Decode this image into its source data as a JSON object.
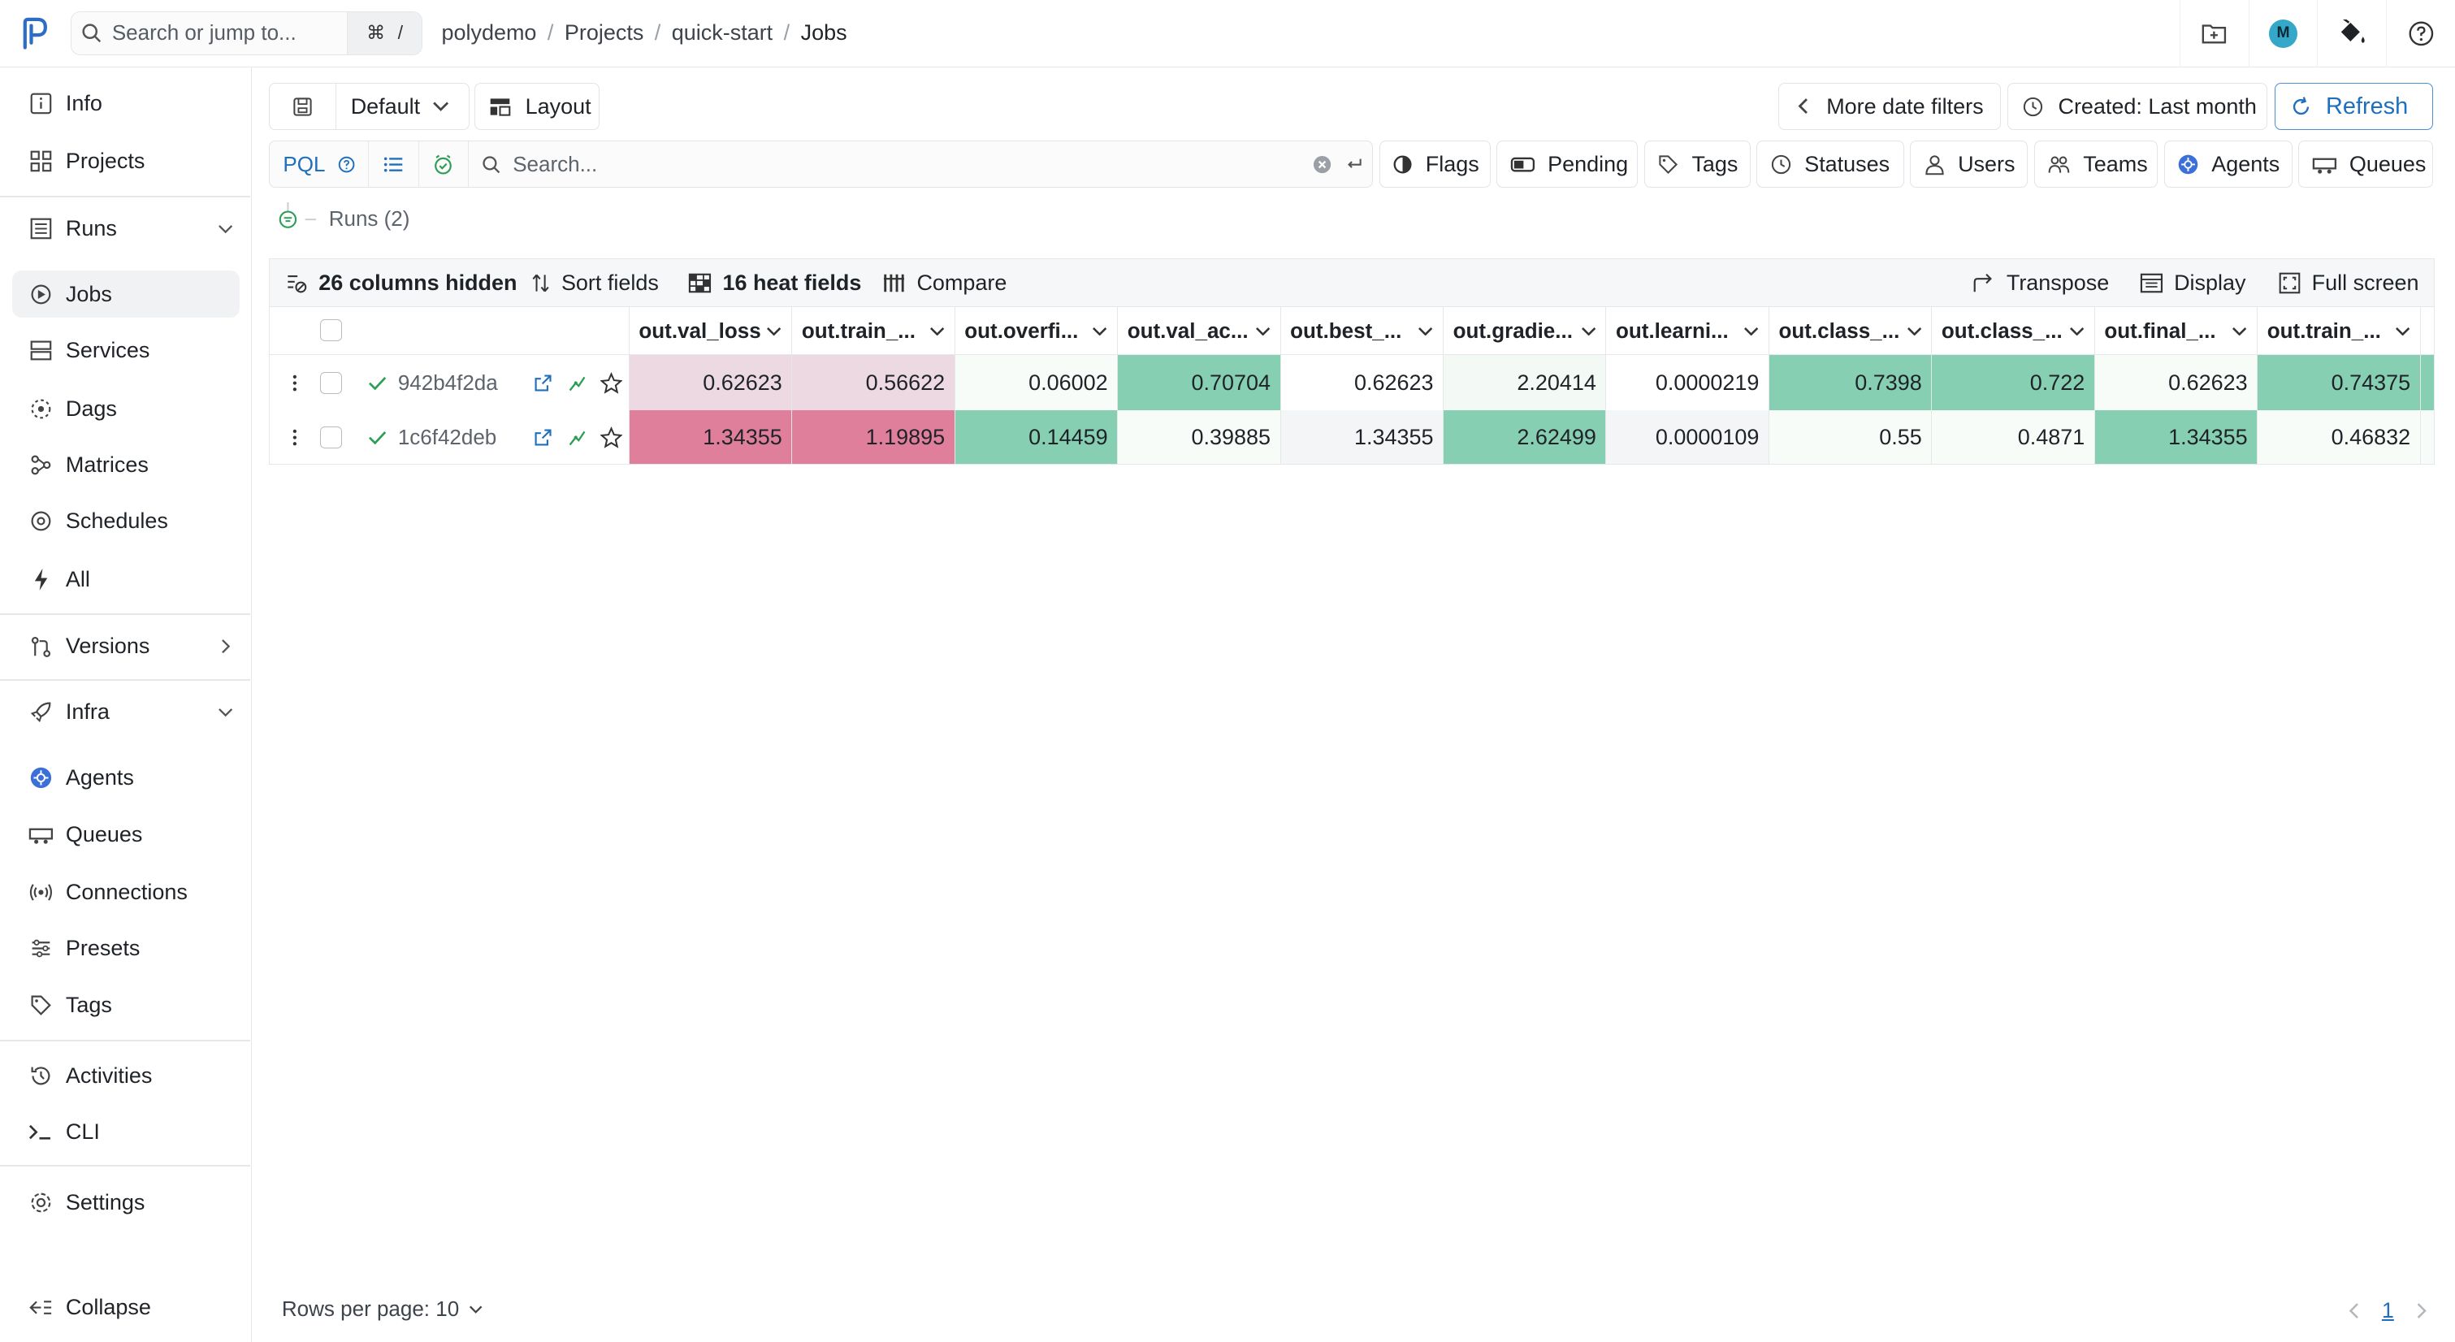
{
  "header": {
    "search_placeholder": "Search or jump to...",
    "shortcut_key1": "⌘",
    "shortcut_key2": "/",
    "breadcrumbs": [
      "polydemo",
      "Projects",
      "quick-start",
      "Jobs"
    ],
    "avatar_initial": "M"
  },
  "sidebar": {
    "items": [
      {
        "label": "Info",
        "icon": "info-icon"
      },
      {
        "label": "Projects",
        "icon": "grid-icon"
      },
      {
        "label": "Runs",
        "icon": "runs-icon"
      },
      {
        "label": "Jobs",
        "icon": "jobs-icon"
      },
      {
        "label": "Services",
        "icon": "services-icon"
      },
      {
        "label": "Dags",
        "icon": "dags-icon"
      },
      {
        "label": "Matrices",
        "icon": "matrices-icon"
      },
      {
        "label": "Schedules",
        "icon": "schedules-icon"
      },
      {
        "label": "All",
        "icon": "bolt-icon"
      },
      {
        "label": "Versions",
        "icon": "versions-icon"
      },
      {
        "label": "Infra",
        "icon": "rocket-icon"
      },
      {
        "label": "Agents",
        "icon": "agents-icon"
      },
      {
        "label": "Queues",
        "icon": "queues-icon"
      },
      {
        "label": "Connections",
        "icon": "connections-icon"
      },
      {
        "label": "Presets",
        "icon": "presets-icon"
      },
      {
        "label": "Tags",
        "icon": "tag-icon"
      },
      {
        "label": "Activities",
        "icon": "history-icon"
      },
      {
        "label": "CLI",
        "icon": "terminal-icon"
      },
      {
        "label": "Settings",
        "icon": "gear-icon"
      }
    ],
    "collapse_label": "Collapse"
  },
  "toolbar": {
    "preset_label": "Default",
    "layout_label": "Layout",
    "more_date_filters": "More date filters",
    "created_filter": "Created: Last month",
    "refresh_label": "Refresh"
  },
  "filters": {
    "pql_label": "PQL",
    "search_placeholder": "Search...",
    "buttons": [
      "Flags",
      "Pending",
      "Tags",
      "Statuses",
      "Users",
      "Teams",
      "Agents",
      "Queues"
    ]
  },
  "runs_label": "Runs (2)",
  "table_toolbar": {
    "columns_hidden": "26 columns hidden",
    "sort_fields": "Sort fields",
    "heat_fields": "16 heat fields",
    "compare": "Compare",
    "transpose": "Transpose",
    "display": "Display",
    "full_screen": "Full screen"
  },
  "table": {
    "columns": [
      "out.val_loss",
      "out.train_...",
      "out.overfi...",
      "out.val_ac...",
      "out.best_...",
      "out.gradie...",
      "out.learni...",
      "out.class_...",
      "out.class_...",
      "out.final_...",
      "out.train_..."
    ],
    "rows": [
      {
        "id": "942b4f2da",
        "values": [
          "0.62623",
          "0.56622",
          "0.06002",
          "0.70704",
          "0.62623",
          "2.20414",
          "0.0000219",
          "0.7398",
          "0.722",
          "0.62623",
          "0.74375"
        ],
        "heat": [
          "#ecd9e1",
          "#ecd9e1",
          "#f7fcf9",
          "#86cfb2",
          "#ffffff",
          "#f3faf6",
          "#ffffff",
          "#86cfb2",
          "#86cfb2",
          "#f7fcf9",
          "#86cfb2"
        ]
      },
      {
        "id": "1c6f42deb",
        "values": [
          "1.34355",
          "1.19895",
          "0.14459",
          "0.39885",
          "1.34355",
          "2.62499",
          "0.0000109",
          "0.55",
          "0.4871",
          "1.34355",
          "0.46832"
        ],
        "heat": [
          "#e07f9b",
          "#e07f9b",
          "#86cfb2",
          "#f7fcf9",
          "#f4f5f7",
          "#86cfb2",
          "#f4f5f7",
          "#f7fcf9",
          "#f7fcf9",
          "#86cfb2",
          "#f7fcf9"
        ]
      }
    ]
  },
  "footer": {
    "rows_per_page": "Rows per page: 10",
    "current_page": "1"
  },
  "colors": {
    "accent": "#1f6fbf",
    "heat_high": "#86cfb2",
    "heat_bad": "#e07f9b",
    "success": "#2e9e57"
  }
}
